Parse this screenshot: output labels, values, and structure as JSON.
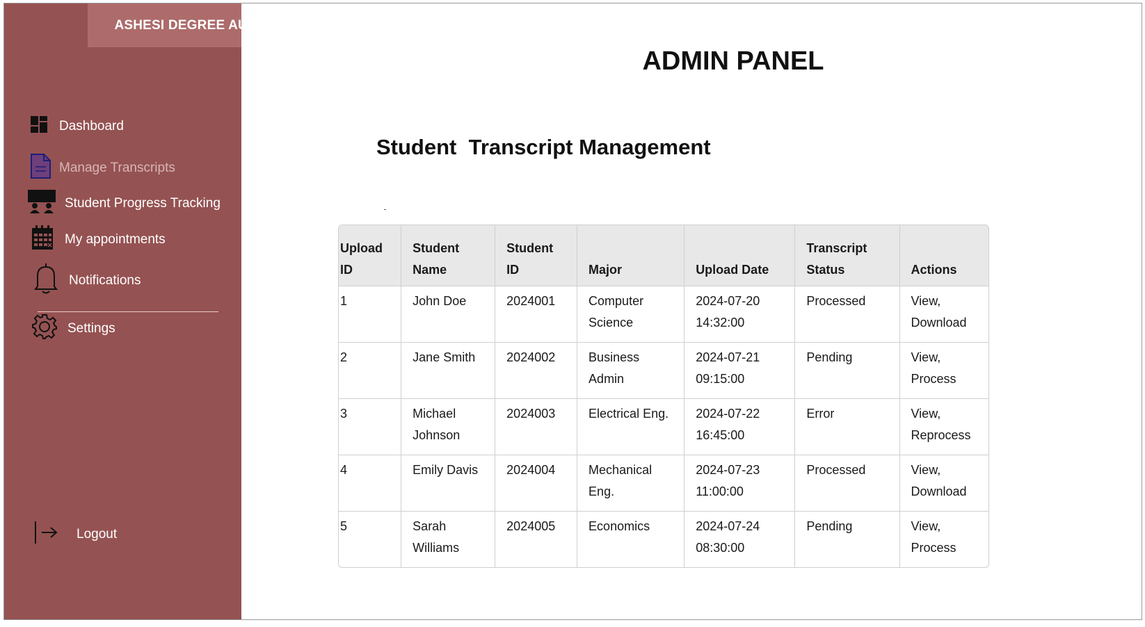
{
  "app": {
    "brand": "ASHESI DEGREE AUDIT PORTAL"
  },
  "colors": {
    "sidebar": "#955252",
    "brand_bar": "#ad6b6b",
    "header_row": "#e8e8e8"
  },
  "sidebar": {
    "items": [
      {
        "label": "Dashboard",
        "icon": "dashboard-grid-icon"
      },
      {
        "label": "Manage Transcripts",
        "icon": "document-icon"
      },
      {
        "label": "Student Progress Tracking",
        "icon": "classroom-icon"
      },
      {
        "label": "My appointments",
        "icon": "calendar-icon"
      },
      {
        "label": "Notifications",
        "icon": "bell-icon"
      },
      {
        "label": "Settings",
        "icon": "gear-icon"
      }
    ],
    "logout": {
      "label": "Logout",
      "icon": "logout-icon"
    }
  },
  "main": {
    "title": "ADMIN PANEL",
    "section_title": "Student  Transcript Management",
    "table": {
      "columns": [
        "Upload ID",
        "Student Name",
        "Student ID",
        "Major",
        "Upload Date",
        "Transcript Status",
        "Actions"
      ],
      "rows": [
        [
          "1",
          "John Doe",
          "2024001",
          "Computer Science",
          "2024-07-20 14:32:00",
          "Processed",
          "View, Download"
        ],
        [
          "2",
          "Jane Smith",
          "2024002",
          "Business Admin",
          "2024-07-21 09:15:00",
          "Pending",
          "View, Process"
        ],
        [
          "3",
          "Michael Johnson",
          "2024003",
          "Electrical Eng.",
          "2024-07-22 16:45:00",
          "Error",
          "View, Reprocess"
        ],
        [
          "4",
          "Emily Davis",
          "2024004",
          "Mechanical Eng.",
          "2024-07-23 11:00:00",
          "Processed",
          "View, Download"
        ],
        [
          "5",
          "Sarah Williams",
          "2024005",
          "Economics",
          "2024-07-24 08:30:00",
          "Pending",
          "View, Process"
        ]
      ]
    }
  }
}
